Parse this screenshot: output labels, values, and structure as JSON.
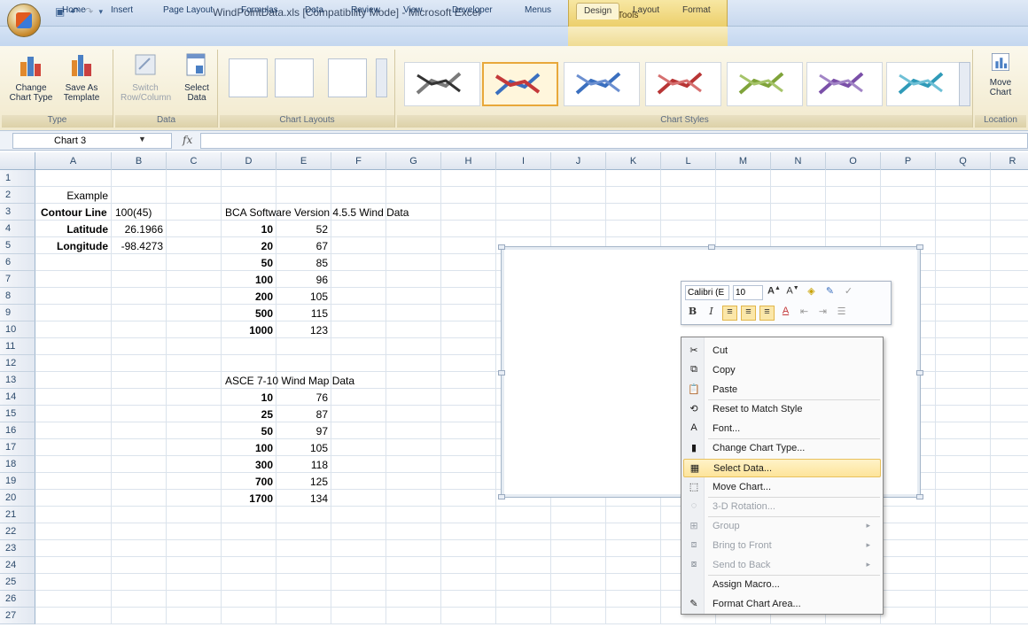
{
  "window": {
    "title": "WindPointData.xls  [Compatibility Mode] - Microsoft Excel",
    "chart_tools_header": "Chart Tools"
  },
  "tabs": [
    "Home",
    "Insert",
    "Page Layout",
    "Formulas",
    "Data",
    "Review",
    "View",
    "Developer",
    "Menus",
    "Design",
    "Layout",
    "Format"
  ],
  "active_tab": "Design",
  "ribbon": {
    "type_group": {
      "label": "Type",
      "change_chart_type": "Change\nChart Type",
      "save_as_template": "Save As\nTemplate"
    },
    "data_group": {
      "label": "Data",
      "switch_row_column": "Switch\nRow/Column",
      "select_data": "Select\nData"
    },
    "chart_layouts_label": "Chart Layouts",
    "chart_styles_label": "Chart Styles",
    "location_group": {
      "label": "Location",
      "move_chart": "Move\nChart"
    }
  },
  "formula_bar": {
    "name_box": "Chart 3",
    "fx": "fx",
    "value": ""
  },
  "columns": [
    "A",
    "B",
    "C",
    "D",
    "E",
    "F",
    "G",
    "H",
    "I",
    "J",
    "K",
    "L",
    "M",
    "N",
    "O",
    "P",
    "Q",
    "R"
  ],
  "rows": [
    "1",
    "2",
    "3",
    "4",
    "5",
    "6",
    "7",
    "8",
    "9",
    "10",
    "11",
    "12",
    "13",
    "14",
    "15",
    "16",
    "17",
    "18",
    "19",
    "20",
    "21",
    "22",
    "23",
    "24",
    "25",
    "26",
    "27"
  ],
  "cells": {
    "A2": "Example",
    "A3": "Contour Line",
    "B3": "100(45)",
    "A4": "Latitude",
    "B4": "26.1966",
    "A5": "Longitude",
    "B5": "-98.4273",
    "D3": "BCA Software Version 4.5.5 Wind Data",
    "bca": [
      [
        "10",
        "52"
      ],
      [
        "20",
        "67"
      ],
      [
        "50",
        "85"
      ],
      [
        "100",
        "96"
      ],
      [
        "200",
        "105"
      ],
      [
        "500",
        "115"
      ],
      [
        "1000",
        "123"
      ]
    ],
    "D13": "ASCE 7-10 Wind Map Data",
    "asce": [
      [
        "10",
        "76"
      ],
      [
        "25",
        "87"
      ],
      [
        "50",
        "97"
      ],
      [
        "100",
        "105"
      ],
      [
        "300",
        "118"
      ],
      [
        "700",
        "125"
      ],
      [
        "1700",
        "134"
      ]
    ]
  },
  "mini_toolbar": {
    "font": "Calibri (E",
    "size": "10"
  },
  "context_menu": {
    "items": [
      {
        "label": "Cut",
        "icon": "scissors-icon",
        "enabled": true
      },
      {
        "label": "Copy",
        "icon": "copy-icon",
        "enabled": true
      },
      {
        "label": "Paste",
        "icon": "paste-icon",
        "enabled": true
      },
      {
        "label": "Reset to Match Style",
        "icon": "reset-style-icon",
        "enabled": true
      },
      {
        "label": "Font...",
        "icon": "font-icon",
        "enabled": true
      },
      {
        "label": "Change Chart Type...",
        "icon": "chart-type-icon",
        "enabled": true
      },
      {
        "label": "Select Data...",
        "icon": "select-data-icon",
        "enabled": true
      },
      {
        "label": "Move Chart...",
        "icon": "move-chart-icon",
        "enabled": true
      },
      {
        "label": "3-D Rotation...",
        "icon": "rotation-icon",
        "enabled": false
      },
      {
        "label": "Group",
        "icon": "group-icon",
        "enabled": false
      },
      {
        "label": "Bring to Front",
        "icon": "bring-front-icon",
        "enabled": false
      },
      {
        "label": "Send to Back",
        "icon": "send-back-icon",
        "enabled": false
      },
      {
        "label": "Assign Macro...",
        "icon": "",
        "enabled": true
      },
      {
        "label": "Format Chart Area...",
        "icon": "format-area-icon",
        "enabled": true
      }
    ],
    "highlighted": "Select Data..."
  }
}
